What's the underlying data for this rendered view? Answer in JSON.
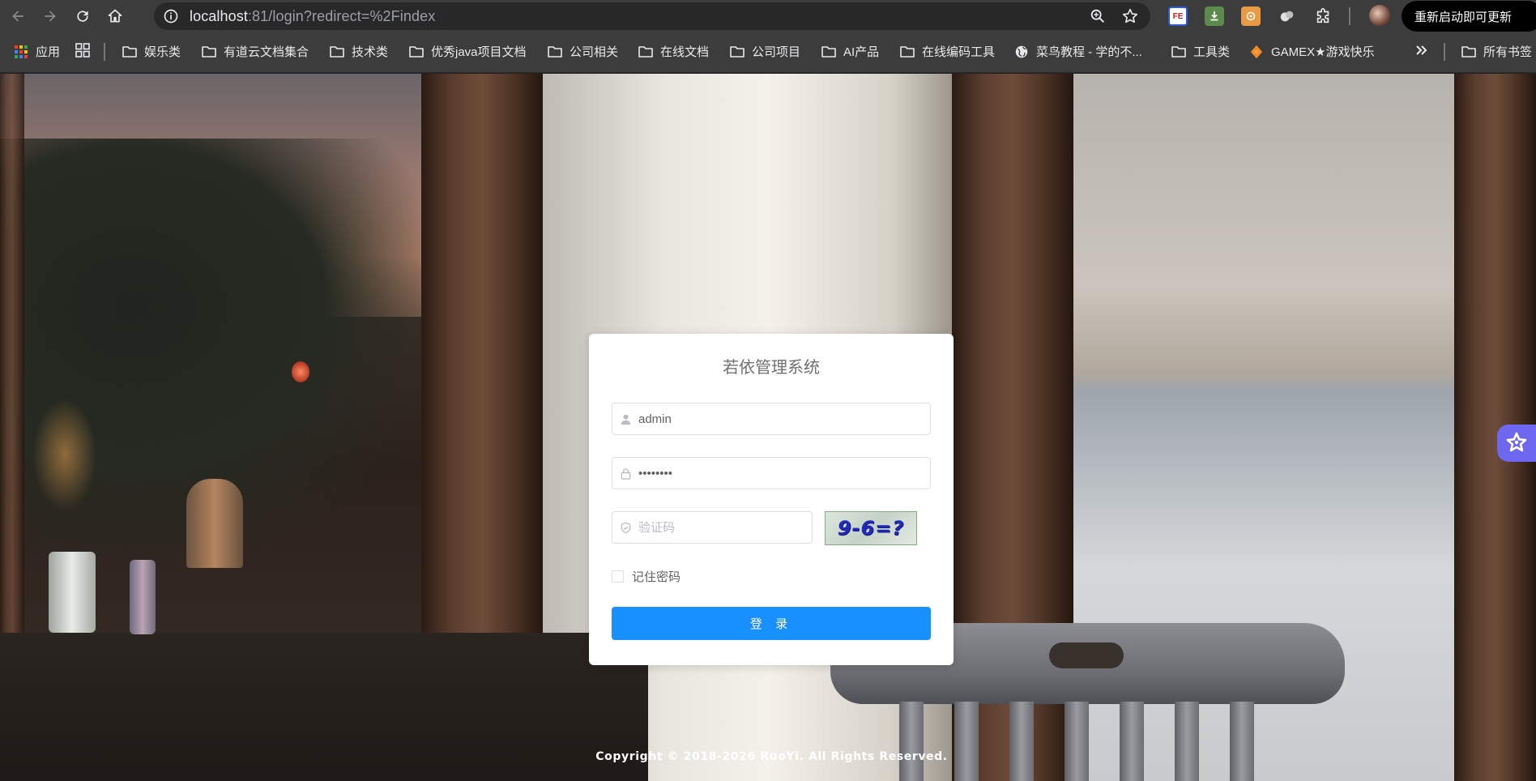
{
  "browser": {
    "url_host": "localhost",
    "url_rest": ":81/login?redirect=%2Findex",
    "update_button": "重新启动即可更新",
    "extension_fe_label": "FE"
  },
  "bookmarks": [
    {
      "label": "应用",
      "icon": "apps-grid-icon"
    },
    {
      "label": "娱乐类",
      "icon": "folder-icon"
    },
    {
      "label": "有道云文档集合",
      "icon": "folder-icon"
    },
    {
      "label": "技术类",
      "icon": "folder-icon"
    },
    {
      "label": "优秀java项目文档",
      "icon": "folder-icon"
    },
    {
      "label": "公司相关",
      "icon": "folder-icon"
    },
    {
      "label": "在线文档",
      "icon": "folder-icon"
    },
    {
      "label": "公司项目",
      "icon": "folder-icon"
    },
    {
      "label": "AI产品",
      "icon": "folder-icon"
    },
    {
      "label": "在线编码工具",
      "icon": "folder-icon"
    },
    {
      "label": "菜鸟教程 - 学的不...",
      "icon": "globe-icon"
    },
    {
      "label": "工具类",
      "icon": "folder-icon"
    },
    {
      "label": "GAMEX★游戏快乐",
      "icon": "gamex-icon"
    },
    {
      "label": "所有书签",
      "icon": "folder-icon"
    }
  ],
  "login": {
    "title": "若依管理系统",
    "username_value": "admin",
    "password_value": "••••••••",
    "captcha_placeholder": "验证码",
    "captcha_text": "9-6=?",
    "remember_label": "记住密码",
    "login_button": "登 录"
  },
  "footer": {
    "copyright": "Copyright © 2018-2026 RuoYi. All Rights Reserved."
  },
  "colors": {
    "primary": "#1890ff",
    "chrome_bg": "#3c3c3c",
    "omnibox_bg": "#282828"
  }
}
